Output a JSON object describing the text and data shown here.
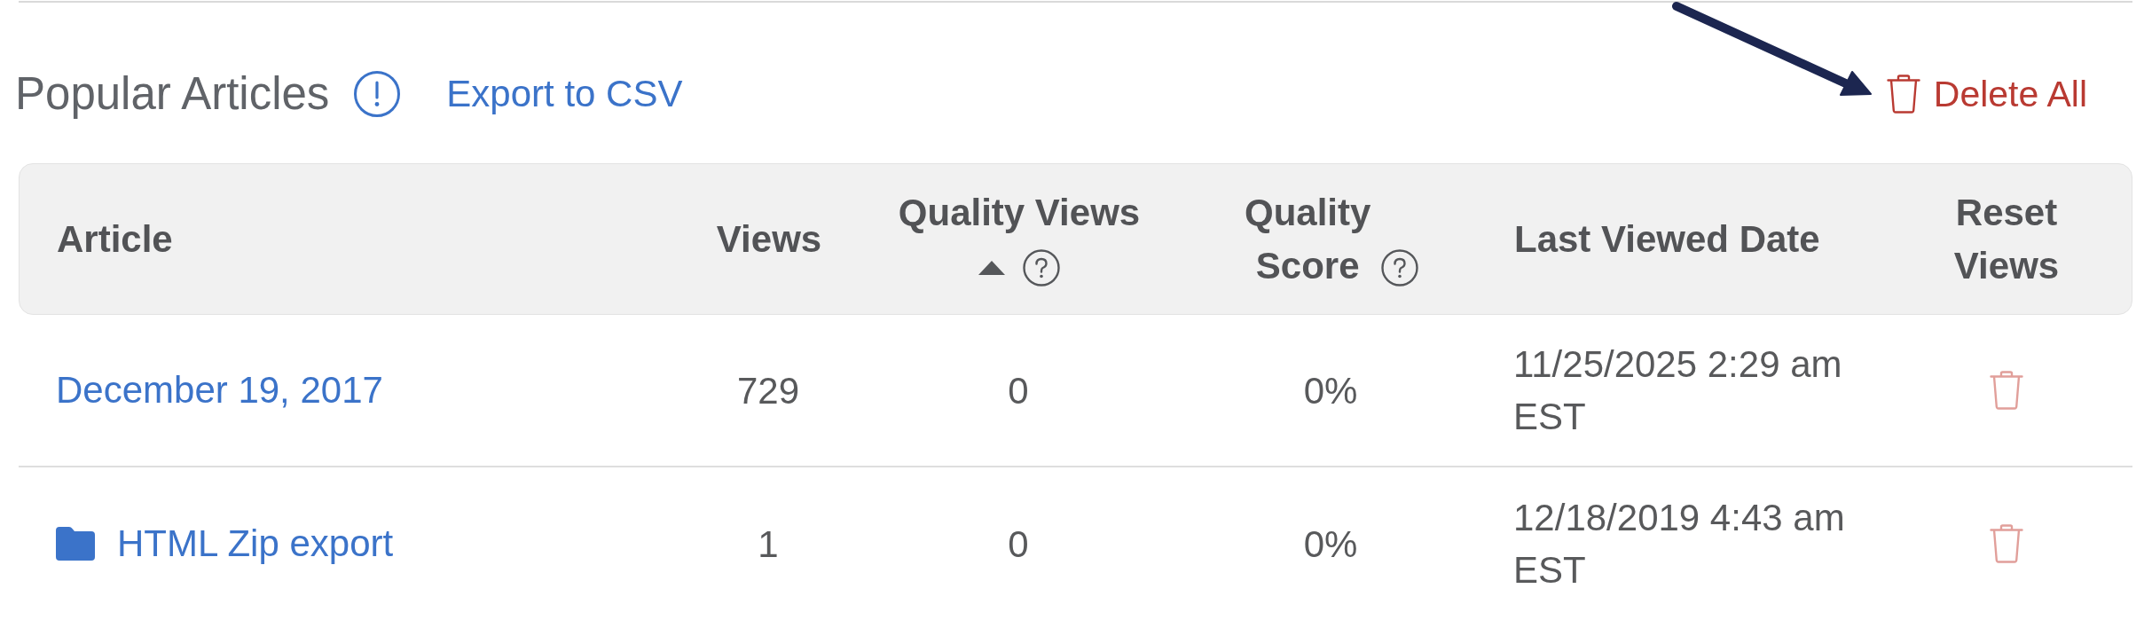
{
  "section": {
    "title": "Popular Articles",
    "export_link": "Export to CSV",
    "delete_all": "Delete All"
  },
  "table": {
    "columns": [
      {
        "label": "Article",
        "sorted": false,
        "help": false
      },
      {
        "label": "Views",
        "sorted": false,
        "help": false
      },
      {
        "label": "Quality Views",
        "sorted": true,
        "help": true
      },
      {
        "label": "Quality Score",
        "sorted": false,
        "help": true
      },
      {
        "label": "Last Viewed Date",
        "sorted": false,
        "help": false
      },
      {
        "label": "Reset Views",
        "sorted": false,
        "help": false
      }
    ],
    "rows": [
      {
        "kind": "article",
        "article": "December 19, 2017",
        "views": "729",
        "quality_views": "0",
        "quality_score": "0%",
        "last_viewed": "11/25/2025 2:29 am EST"
      },
      {
        "kind": "folder",
        "article": "HTML Zip export",
        "views": "1",
        "quality_views": "0",
        "quality_score": "0%",
        "last_viewed": "12/18/2019 4:43 am EST"
      }
    ]
  }
}
